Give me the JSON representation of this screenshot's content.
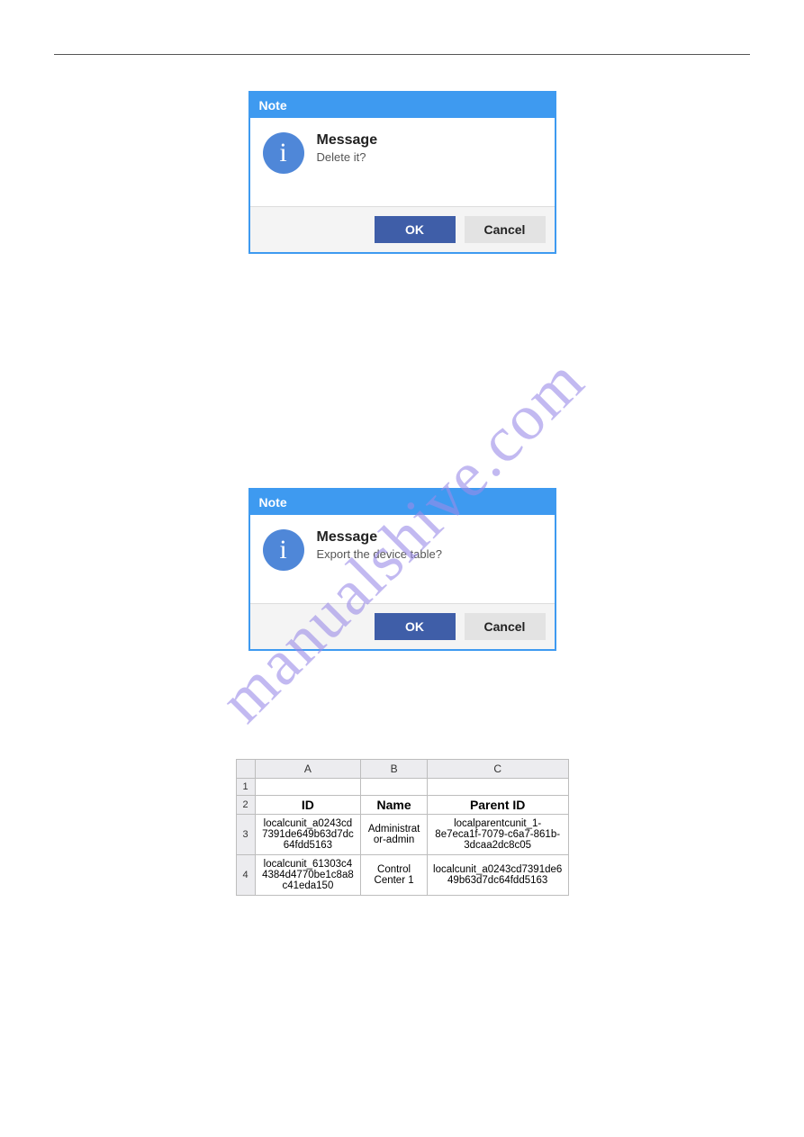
{
  "watermark": "manualshive.com",
  "dialog1": {
    "title": "Note",
    "icon_letter": "i",
    "heading": "Message",
    "text": "Delete it?",
    "ok": "OK",
    "cancel": "Cancel"
  },
  "dialog2": {
    "title": "Note",
    "icon_letter": "i",
    "heading": "Message",
    "text": "Export the device table?",
    "ok": "OK",
    "cancel": "Cancel"
  },
  "sheet": {
    "col_letters": [
      "A",
      "B",
      "C"
    ],
    "row_numbers": [
      "1",
      "2",
      "3",
      "4"
    ],
    "headers": [
      "ID",
      "Name",
      "Parent ID"
    ],
    "rows": [
      {
        "id": "localcunit_a0243cd7391de649b63d7dc64fdd5163",
        "name": "Administrator-admin",
        "parent": "localparentcunit_1-8e7eca1f-7079-c6a7-861b-3dcaa2dc8c05"
      },
      {
        "id": "localcunit_61303c44384d4770be1c8a8c41eda150",
        "name": "Control Center 1",
        "parent": "localcunit_a0243cd7391de649b63d7dc64fdd5163"
      }
    ]
  }
}
